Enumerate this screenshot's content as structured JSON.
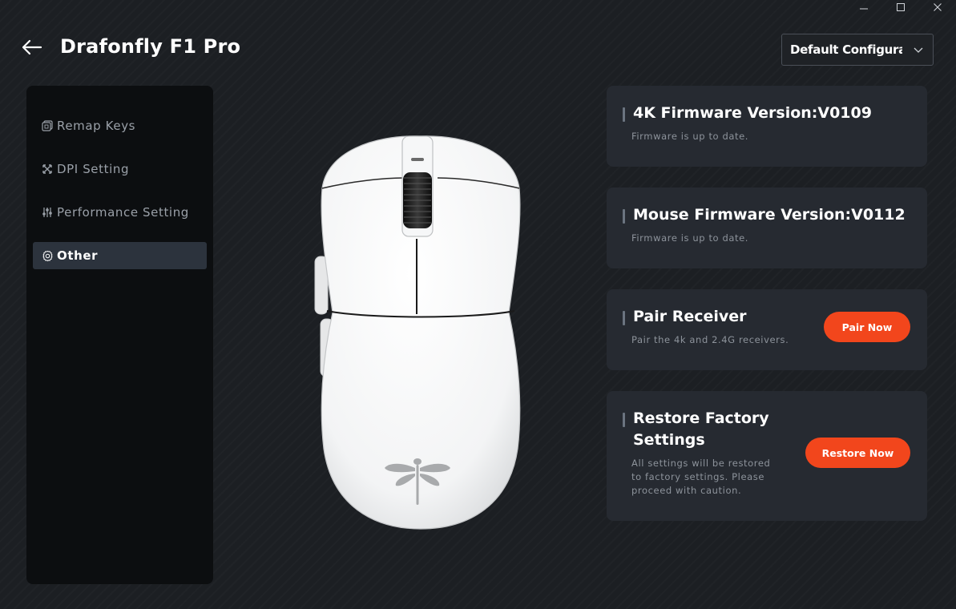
{
  "window": {
    "minimize_icon": "minimize-icon",
    "maximize_icon": "maximize-icon",
    "close_icon": "close-icon"
  },
  "header": {
    "title": "Drafonfly F1 Pro",
    "back_icon": "arrow-left-icon",
    "config_select": {
      "value": "Default Configuration",
      "chevron_icon": "chevron-down-icon"
    }
  },
  "sidebar": {
    "items": [
      {
        "label": "Remap Keys",
        "icon": "keyboard-icon",
        "active": false
      },
      {
        "label": "DPI Setting",
        "icon": "cross-arrows-icon",
        "active": false
      },
      {
        "label": "Performance Setting",
        "icon": "sliders-icon",
        "active": false
      },
      {
        "label": "Other",
        "icon": "gear-icon",
        "active": true
      }
    ]
  },
  "main": {
    "device_image": "white-mouse-dragonfly-logo",
    "cards": [
      {
        "title": "4K Firmware Version:V0109",
        "desc": "Firmware is up to date."
      },
      {
        "title": "Mouse Firmware Version:V0112",
        "desc": "Firmware is up to date."
      },
      {
        "title": "Pair Receiver",
        "desc": "Pair the 4k and 2.4G receivers.",
        "button": "Pair Now"
      },
      {
        "title_line1": "Restore Factory",
        "title_line2": "Settings",
        "desc_line1": "All settings will be restored",
        "desc_line2": "to factory settings. Please",
        "desc_line3": "proceed with caution.",
        "button": "Restore Now"
      }
    ]
  },
  "colors": {
    "accent": "#f2461c",
    "background": "#1c1f23",
    "sidebar": "#0c0e10",
    "card": "#262a31",
    "active_nav": "#2c333d"
  }
}
